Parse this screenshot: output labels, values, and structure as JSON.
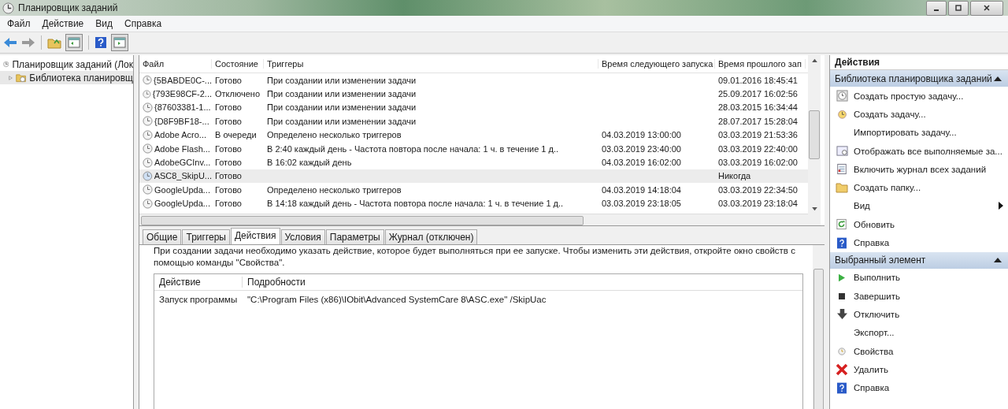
{
  "window": {
    "title": "Планировщик заданий"
  },
  "menu": [
    "Файл",
    "Действие",
    "Вид",
    "Справка"
  ],
  "tree": [
    {
      "label": "Планировщик заданий (Лок",
      "selected": false,
      "children": [
        {
          "label": "Библиотека планировщ",
          "selected": true,
          "expanded": false
        }
      ]
    }
  ],
  "table": {
    "columns": [
      "Файл",
      "Состояние",
      "Триггеры",
      "Время следующего запуска",
      "Время прошлого зап"
    ],
    "rows": [
      {
        "cells": [
          "{5BABDE0C-...",
          "Готово",
          "При создании или изменении задачи",
          "",
          "09.01.2016 18:45:41"
        ],
        "selected": false
      },
      {
        "cells": [
          "{793E98CF-2...",
          "Отключено",
          "При создании или изменении задачи",
          "",
          "25.09.2017 16:02:56"
        ],
        "selected": false
      },
      {
        "cells": [
          "{87603381-1...",
          "Готово",
          "При создании или изменении задачи",
          "",
          "28.03.2015 16:34:44"
        ],
        "selected": false
      },
      {
        "cells": [
          "{D8F9BF18-...",
          "Готово",
          "При создании или изменении задачи",
          "",
          "28.07.2017 15:28:04"
        ],
        "selected": false
      },
      {
        "cells": [
          "Adobe Acro...",
          "В очереди",
          "Определено несколько триггеров",
          "04.03.2019 13:00:00",
          "03.03.2019 21:53:36"
        ],
        "selected": false
      },
      {
        "cells": [
          "Adobe Flash...",
          "Готово",
          "В 2:40 каждый день - Частота повтора после начала: 1 ч. в течение 1 д..",
          "03.03.2019 23:40:00",
          "03.03.2019 22:40:00"
        ],
        "selected": false
      },
      {
        "cells": [
          "AdobeGCInv...",
          "Готово",
          "В 16:02 каждый день",
          "04.03.2019 16:02:00",
          "03.03.2019 16:02:00"
        ],
        "selected": false
      },
      {
        "cells": [
          "ASC8_SkipU...",
          "Готово",
          "",
          "",
          "Никогда"
        ],
        "selected": true
      },
      {
        "cells": [
          "GoogleUpda...",
          "Готово",
          "Определено несколько триггеров",
          "04.03.2019 14:18:04",
          "03.03.2019 22:34:50"
        ],
        "selected": false
      },
      {
        "cells": [
          "GoogleUpda...",
          "Готово",
          "В 14:18 каждый день - Частота повтора после начала: 1 ч. в течение 1 д..",
          "03.03.2019 23:18:05",
          "03.03.2019 23:18:04"
        ],
        "selected": false
      }
    ]
  },
  "tabs": [
    {
      "label": "Общие",
      "selected": false
    },
    {
      "label": "Триггеры",
      "selected": false
    },
    {
      "label": "Действия",
      "selected": true
    },
    {
      "label": "Условия",
      "selected": false
    },
    {
      "label": "Параметры",
      "selected": false
    },
    {
      "label": "Журнал (отключен)",
      "selected": false
    }
  ],
  "details": {
    "description": "При создании задачи необходимо указать действие, которое будет выполняться при ее запуске.  Чтобы изменить эти действия, откройте окно свойств с помощью команды \"Свойства\".",
    "columns": [
      "Действие",
      "Подробности"
    ],
    "rows": [
      [
        "Запуск программы",
        "\"C:\\Program Files (x86)\\IObit\\Advanced SystemCare 8\\ASC.exe\" /SkipUac"
      ]
    ]
  },
  "actions": {
    "title": "Действия",
    "sections": [
      {
        "title": "Библиотека планировщика заданий",
        "expanded": true,
        "items": [
          {
            "label": "Создать простую задачу...",
            "kind": "wizard"
          },
          {
            "label": "Создать задачу...",
            "kind": "task"
          },
          {
            "label": "Импортировать задачу...",
            "kind": "plain"
          },
          {
            "label": "Отображать все выполняемые за...",
            "kind": "running"
          },
          {
            "label": "Включить журнал всех заданий",
            "kind": "log"
          },
          {
            "label": "Создать папку...",
            "kind": "folder"
          },
          {
            "label": "Вид",
            "kind": "submenu"
          },
          {
            "label": "Обновить",
            "kind": "refresh"
          },
          {
            "label": "Справка",
            "kind": "help"
          }
        ]
      },
      {
        "title": "Выбранный элемент",
        "expanded": true,
        "items": [
          {
            "label": "Выполнить",
            "kind": "run"
          },
          {
            "label": "Завершить",
            "kind": "stop"
          },
          {
            "label": "Отключить",
            "kind": "disable"
          },
          {
            "label": "Экспорт...",
            "kind": "plain"
          },
          {
            "label": "Свойства",
            "kind": "properties"
          },
          {
            "label": "Удалить",
            "kind": "delete"
          },
          {
            "label": "Справка",
            "kind": "help"
          }
        ]
      }
    ]
  }
}
